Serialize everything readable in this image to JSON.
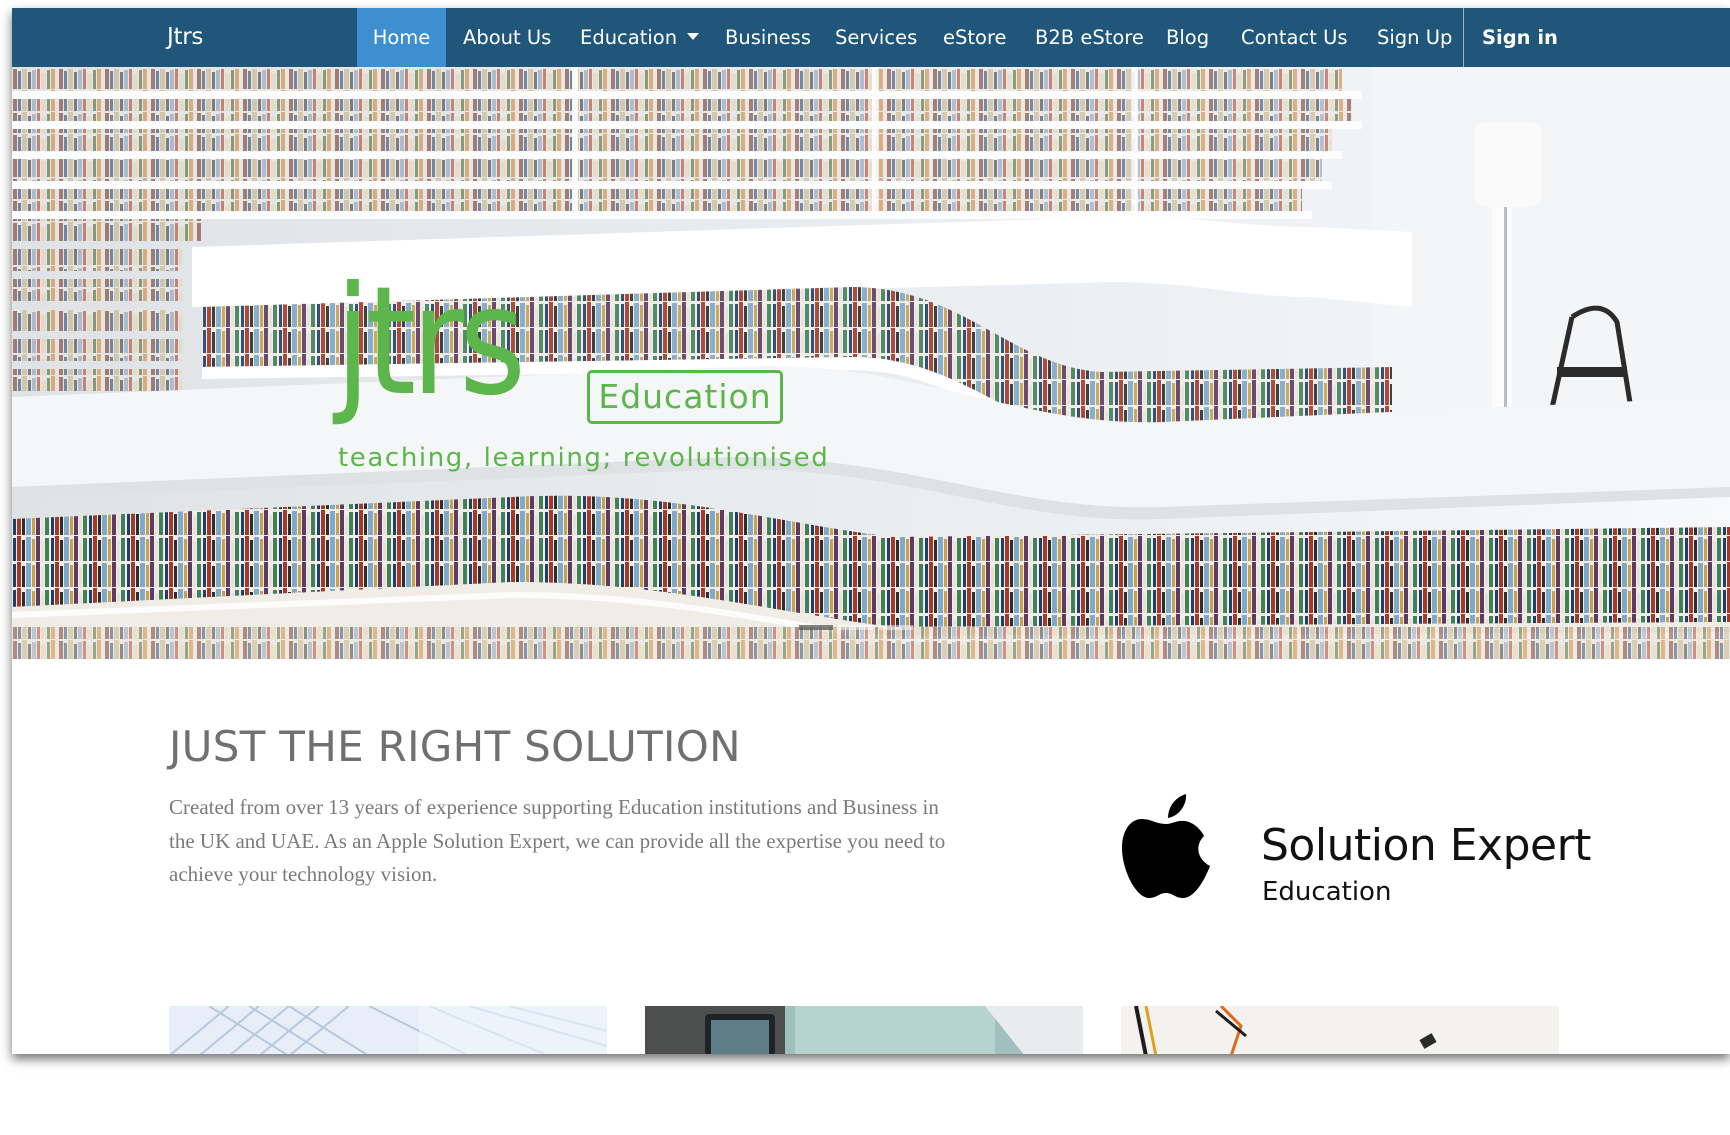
{
  "navbar": {
    "brand": "Jtrs",
    "items": [
      {
        "label": "Home",
        "active": true
      },
      {
        "label": "About Us"
      },
      {
        "label": "Education",
        "dropdown": true
      },
      {
        "label": "Business"
      },
      {
        "label": "Services"
      },
      {
        "label": "eStore"
      },
      {
        "label": "B2B eStore"
      },
      {
        "label": "Blog"
      },
      {
        "label": "Contact Us"
      },
      {
        "label": "Sign Up"
      }
    ],
    "signin": "Sign in",
    "colors": {
      "bar": "#205679",
      "active": "#3e8fd0"
    }
  },
  "hero": {
    "logo_wordmark": "jtrs",
    "logo_badge": "Education",
    "tagline": "teaching, learning; revolutionised",
    "logo_color": "#5cb64c",
    "carousel_active_index": 0,
    "carousel_count": 3
  },
  "intro": {
    "headline": "JUST THE RIGHT SOLUTION",
    "body": "Created from over 13 years of experience supporting Education institutions and Business in the UK and UAE. As an Apple Solution Expert, we can provide all the expertise you need to achieve your technology vision."
  },
  "badge": {
    "icon": "apple-icon",
    "title": "Solution Expert",
    "subtitle": "Education"
  },
  "thumbnails": [
    "architecture-image",
    "tablet-image",
    "cables-image"
  ]
}
